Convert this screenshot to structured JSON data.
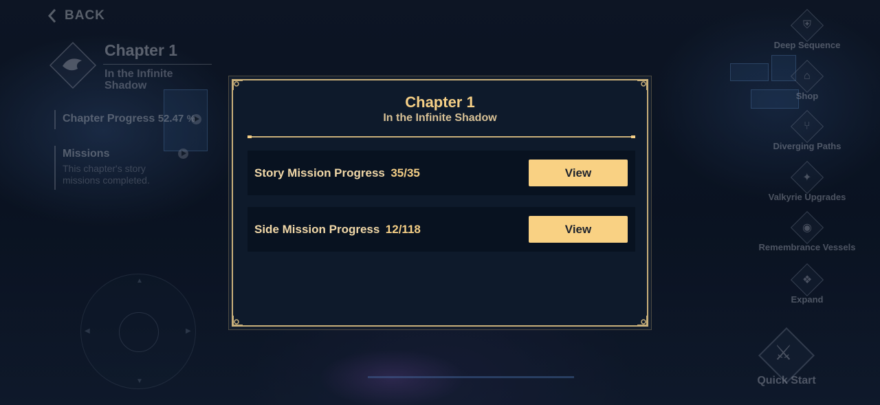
{
  "back": {
    "label": "BACK"
  },
  "chapter_panel": {
    "title": "Chapter 1",
    "subtitle": "In the Infinite Shadow",
    "progress_label": "Chapter Progress",
    "progress_value": "52.47",
    "progress_unit": "%",
    "missions_label": "Missions",
    "missions_note": "This chapter's story missions completed."
  },
  "right_menu": [
    {
      "label": "Deep Sequence",
      "icon": "deep-sequence-icon"
    },
    {
      "label": "Shop",
      "icon": "shop-icon"
    },
    {
      "label": "Diverging Paths",
      "icon": "diverging-paths-icon"
    },
    {
      "label": "Valkyrie Upgrades",
      "icon": "valkyrie-upgrades-icon"
    },
    {
      "label": "Remembrance Vessels",
      "icon": "remembrance-vessels-icon"
    },
    {
      "label": "Expand",
      "icon": "expand-icon"
    }
  ],
  "quick_start": {
    "label": "Quick Start",
    "icon": "swords-icon"
  },
  "modal": {
    "title": "Chapter 1",
    "subtitle": "In the Infinite Shadow",
    "rows": [
      {
        "label": "Story Mission Progress",
        "value": "35/35",
        "button": "View"
      },
      {
        "label": "Side Mission Progress",
        "value": "12/118",
        "button": "View"
      }
    ]
  },
  "colors": {
    "accent_gold": "#f5cf86",
    "button_bg": "#f9d183",
    "frame": "#c9b07a",
    "panel_bg": "#0e1a2b"
  }
}
